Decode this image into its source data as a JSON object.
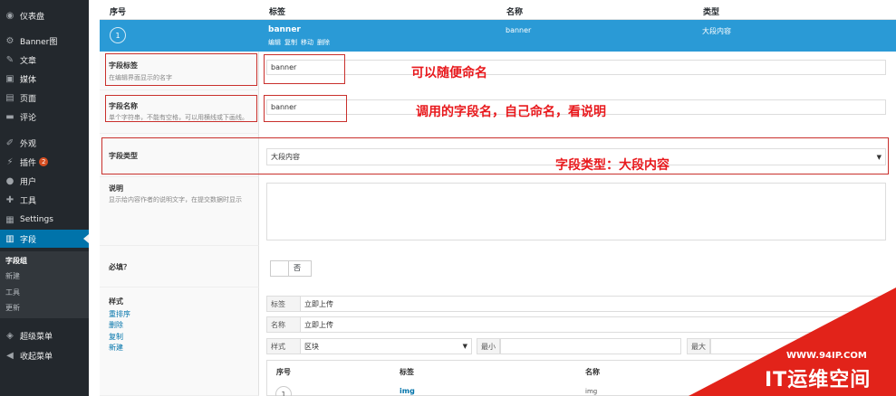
{
  "sidebar": {
    "items": [
      {
        "label": "仪表盘",
        "icon": "dashboard-icon",
        "glyph": "◉"
      },
      {
        "label": "Banner图",
        "icon": "gear-icon",
        "glyph": "⚙"
      },
      {
        "label": "文章",
        "icon": "pin-icon",
        "glyph": "✎"
      },
      {
        "label": "媒体",
        "icon": "media-icon",
        "glyph": "▣"
      },
      {
        "label": "页面",
        "icon": "page-icon",
        "glyph": "▤"
      },
      {
        "label": "评论",
        "icon": "comment-icon",
        "glyph": "▬"
      },
      {
        "label": "外观",
        "icon": "brush-icon",
        "glyph": "✐"
      },
      {
        "label": "插件",
        "icon": "plugin-icon",
        "glyph": "⚡",
        "badge": "2"
      },
      {
        "label": "用户",
        "icon": "user-icon",
        "glyph": "●"
      },
      {
        "label": "工具",
        "icon": "wrench-icon",
        "glyph": "✚"
      },
      {
        "label": "Settings",
        "icon": "settings-icon",
        "glyph": "▦"
      },
      {
        "label": "字段",
        "icon": "fields-icon",
        "glyph": "▥"
      }
    ],
    "submenu": [
      "字段组",
      "新建",
      "工具",
      "更新"
    ],
    "bottom": [
      {
        "label": "超级菜单",
        "icon": "cube-icon",
        "glyph": "◈"
      },
      {
        "label": "收起菜单",
        "icon": "collapse-icon",
        "glyph": "◀"
      }
    ]
  },
  "table_header": {
    "order": "序号",
    "label": "标签",
    "name": "名称",
    "type": "类型"
  },
  "field_row": {
    "order": "1",
    "label": "banner",
    "actions": [
      "编辑",
      "复制",
      "移动",
      "删除"
    ],
    "name": "banner",
    "type": "大段内容"
  },
  "settings": {
    "label": {
      "title": "字段标签",
      "desc": "在编辑界面显示的名字",
      "value": "banner"
    },
    "name": {
      "title": "字段名称",
      "desc": "单个字符串，不能有空格，可以用横线或下画线。",
      "value": "banner"
    },
    "type": {
      "title": "字段类型",
      "value": "大段内容"
    },
    "instructions": {
      "title": "说明",
      "desc": "显示给内容作者的说明文字，在提交数据时显示"
    },
    "required": {
      "title": "必填？",
      "value": "否"
    },
    "layout": {
      "title": "样式",
      "links": [
        "重排序",
        "删除",
        "复制",
        "新建"
      ],
      "label_prefix": "标签",
      "label_value": "立即上传",
      "name_prefix": "名称",
      "name_value": "立即上传",
      "style_prefix": "样式",
      "style_value": "区块",
      "min_prefix": "最小",
      "max_prefix": "最大"
    }
  },
  "sub_table_header": {
    "order": "序号",
    "label": "标签",
    "name": "名称"
  },
  "sub_row": {
    "order": "1",
    "label": "img",
    "name": "img"
  },
  "annotations": {
    "a1": "可以随便命名",
    "a2": "调用的字段名，自己命名，看说明",
    "a3": "字段类型：大段内容"
  },
  "watermark": {
    "url": "WWW.94IP.COM",
    "text": "IT运维空间"
  },
  "colors": {
    "sidebar": "#23282d",
    "accent": "#0073aa",
    "row_highlight": "#2a9ad6",
    "annotation": "#e8191d",
    "watermark": "#e2231a"
  }
}
